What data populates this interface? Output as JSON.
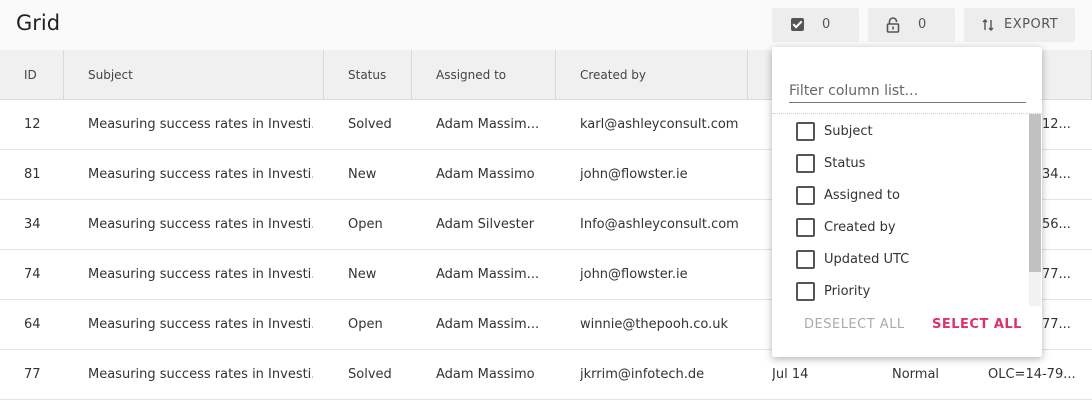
{
  "header": {
    "title": "Grid",
    "selected_count": "0",
    "locked_count": "0",
    "export_label": "EXPORT"
  },
  "columns": [
    "ID",
    "Subject",
    "Status",
    "Assigned to",
    "Created by"
  ],
  "rows": [
    {
      "id": "12",
      "subject": "Measuring success rates in Investi...",
      "status": "Solved",
      "assigned": "Adam Massim...",
      "created_by": "karl@ashleyconsult.com",
      "updated": "",
      "priority": "",
      "extra": "12..."
    },
    {
      "id": "81",
      "subject": "Measuring success rates in Investi...",
      "status": "New",
      "assigned": "Adam Massimo",
      "created_by": "john@flowster.ie",
      "updated": "",
      "priority": "",
      "extra": "34..."
    },
    {
      "id": "34",
      "subject": "Measuring success rates in Investi...",
      "status": "Open",
      "assigned": "Adam Silvester",
      "created_by": "Info@ashleyconsult.com",
      "updated": "",
      "priority": "",
      "extra": "56..."
    },
    {
      "id": "74",
      "subject": "Measuring success rates in Investi...",
      "status": "New",
      "assigned": "Adam Massim...",
      "created_by": "john@flowster.ie",
      "updated": "",
      "priority": "",
      "extra": "77..."
    },
    {
      "id": "64",
      "subject": "Measuring success rates in Investi...",
      "status": "Open",
      "assigned": "Adam Massim...",
      "created_by": "winnie@thepooh.co.uk",
      "updated": "",
      "priority": "",
      "extra": "77..."
    },
    {
      "id": "77",
      "subject": "Measuring success rates in Investi...",
      "status": "Solved",
      "assigned": "Adam Massimo",
      "created_by": "jkrrim@infotech.de",
      "updated": "Jul 14",
      "priority": "Normal",
      "extra": "OLC=14-79..."
    }
  ],
  "column_menu": {
    "filter_placeholder": "Filter column list...",
    "items": [
      "Subject",
      "Status",
      "Assigned to",
      "Created by",
      "Updated UTC",
      "Priority"
    ],
    "deselect_all": "DESELECT ALL",
    "select_all": "SELECT ALL"
  }
}
